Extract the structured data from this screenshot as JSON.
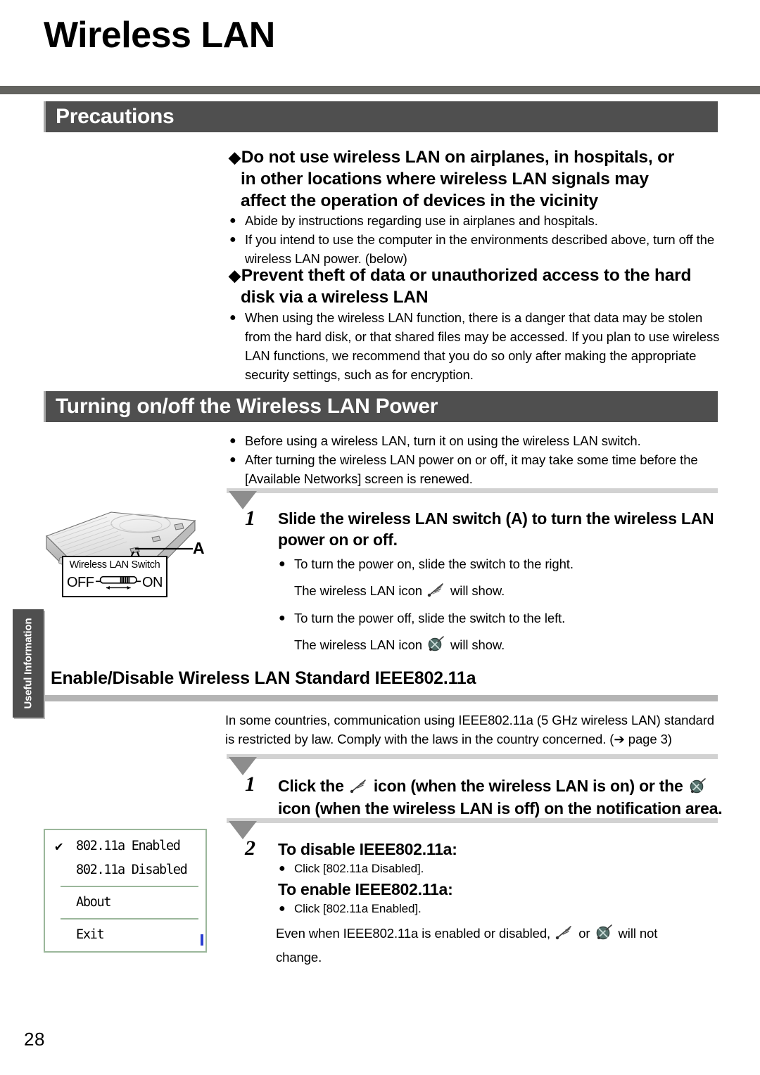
{
  "page": {
    "title": "Wireless LAN",
    "number": "28",
    "side_tab": "Useful Information"
  },
  "sections": {
    "precautions": {
      "heading": "Precautions",
      "items": [
        {
          "diamond": "◆",
          "heading_lines": [
            "Do not use wireless LAN on airplanes, in hospitals, or",
            "in other locations where wireless LAN signals may",
            "affect the operation of devices in the vicinity"
          ],
          "bullets": [
            "Abide by instructions regarding use in airplanes and hospitals.",
            "If you intend to use the computer in the environments described above, turn off the wireless LAN power. (below)"
          ]
        },
        {
          "diamond": "◆",
          "heading_lines": [
            "Prevent theft of data or unauthorized access to the hard",
            "disk via a wireless LAN"
          ],
          "bullets": [
            "When using the wireless LAN function, there is a danger that data may be stolen from the hard disk, or that shared files may be accessed. If you plan to use wireless LAN functions, we recommend that you do so only after making the appropriate security settings, such as for encryption."
          ]
        }
      ]
    },
    "turning_power": {
      "heading": "Turning on/off the Wireless LAN Power",
      "intro_bullets": [
        "Before using a wireless LAN, turn it on using the wireless LAN switch.",
        "After turning the wireless LAN power on or off, it may take some time before the [Available Networks] screen is renewed."
      ],
      "step1": {
        "number": "1",
        "title_lines": [
          "Slide the wireless LAN switch (A) to turn the wireless LAN",
          "power on or off."
        ],
        "bullet_on": "To turn the power on, slide the switch to the right.",
        "note_on_pre": "The wireless LAN icon",
        "note_on_post": "will show.",
        "bullet_off": "To turn the power off, slide the switch to the left.",
        "note_off_pre": "The wireless LAN icon",
        "note_off_post": "will show."
      },
      "figure": {
        "callout_letter": "A",
        "callout_title": "Wireless LAN Switch",
        "switch_off_label": "OFF",
        "switch_on_label": "ON"
      }
    },
    "enable_disable": {
      "heading": "Enable/Disable Wireless LAN Standard IEEE802.11a",
      "intro_lines": [
        "In some countries, communication using IEEE802.11a (5 GHz wireless LAN) standard",
        "is restricted by law. Comply with the laws in the country concerned. (➔ page 3)"
      ],
      "step1": {
        "number": "1",
        "line1_a": "Click the",
        "line1_b": "icon (when the wireless LAN is on) or the",
        "line2": "icon (when the wireless LAN is off) on the notification area."
      },
      "step2": {
        "number": "2",
        "disable_title": "To disable IEEE802.11a:",
        "disable_bullet": "Click [802.11a Disabled].",
        "enable_title": "To enable IEEE802.11a:",
        "enable_bullet": "Click [802.11a Enabled].",
        "note_a": "Even when IEEE802.11a is enabled or disabled,",
        "note_or": "or",
        "note_b": "will not",
        "note_c": "change."
      },
      "context_menu": {
        "checkmark": "✔",
        "items": [
          "802.11a Enabled",
          "802.11a Disabled",
          "About",
          "Exit"
        ]
      }
    }
  },
  "icons": {
    "wlan_on": "wireless-lan-on-icon",
    "wlan_off": "wireless-lan-off-icon",
    "bullet": "●",
    "diamond": "◆",
    "arrow_right": "➔"
  },
  "colors": {
    "header_bar": "#4f4f4f",
    "title_rule": "#63635f",
    "sub_rule": "#b4b4b4",
    "step_rule": "#d2d2d2",
    "step_triangle": "#8d8d8d",
    "menu_border": "#9bb79b"
  }
}
